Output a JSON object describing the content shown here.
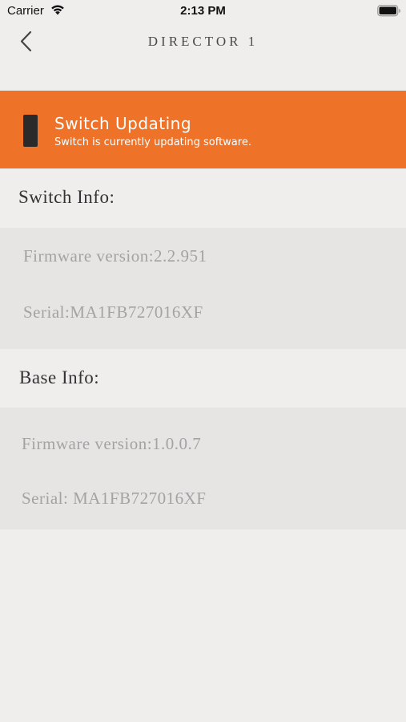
{
  "status_bar": {
    "carrier": "Carrier",
    "time": "2:13 PM"
  },
  "nav": {
    "title": "DIRECTOR 1"
  },
  "banner": {
    "title": "Switch Updating",
    "subtitle": "Switch is currently updating software.",
    "color": "#ee7227"
  },
  "switch_info": {
    "header": "Switch Info:",
    "firmware": "Firmware version:2.2.951",
    "serial": "Serial:MA1FB727016XF"
  },
  "base_info": {
    "header": "Base Info:",
    "firmware": "Firmware version:1.0.0.7",
    "serial": "Serial: MA1FB727016XF"
  }
}
